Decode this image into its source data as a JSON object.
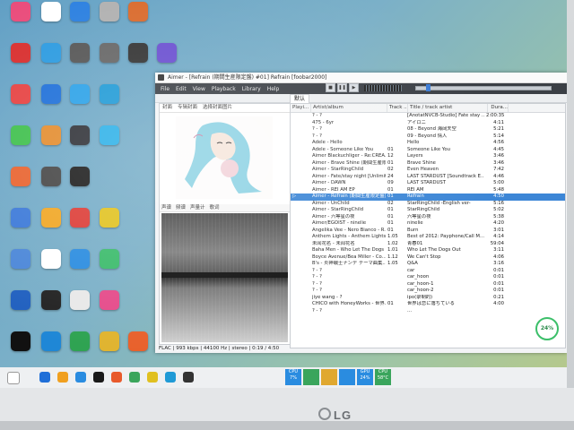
{
  "window": {
    "title": "Aimer - [Refrain (期間生産限定盤) #01] Refrain  [foobar2000]",
    "menu": [
      "File",
      "Edit",
      "View",
      "Playback",
      "Library",
      "Help"
    ],
    "tab": "默认",
    "left_tabs": [
      "封面",
      "专辑封面",
      "选择封面图片"
    ],
    "left_tabs2": [
      "声谱",
      "频谱",
      "声量计",
      "歌词"
    ],
    "status": "FLAC | 993 kbps | 44100 Hz | stereo | 0:19 / 4:50",
    "seek_progress": 0.07
  },
  "playlist": {
    "headers": [
      "Playi...",
      "Artist/album",
      "Track ...",
      "Title / track artist",
      "Dura..."
    ],
    "rows": [
      {
        "artist": "? - ?",
        "track": "",
        "title": "[AnotatNVCB-Studio] Fate stay ...",
        "dur": "2:00:35"
      },
      {
        "artist": "475 - 6yr",
        "track": "",
        "title": "アイロニ",
        "dur": "4:11"
      },
      {
        "artist": "? - ?",
        "track": "",
        "title": "08 - Beyond 海阔天空",
        "dur": "5:21"
      },
      {
        "artist": "? - ?",
        "track": "",
        "title": "09 - Beyond 情人",
        "dur": "5:14"
      },
      {
        "artist": "Adele - Hello",
        "track": "",
        "title": "Hello",
        "dur": "4:56"
      },
      {
        "artist": "Adele - Someone Like You",
        "track": "01",
        "title": "Someone Like You",
        "dur": "4:45"
      },
      {
        "artist": "Aimer Blackuchliger - Re:CREA...",
        "track": "12",
        "title": "Layers",
        "dur": "3:46"
      },
      {
        "artist": "Aimer - Brave Shine (期間生産限定盤)",
        "track": "01",
        "title": "Brave Shine",
        "dur": "3:46"
      },
      {
        "artist": "Aimer - StarRingChild",
        "track": "02",
        "title": "Even Heaven",
        "dur": "7:42"
      },
      {
        "artist": "Aimer - Fate/stay night [Unlimit...",
        "track": "24",
        "title": "LAST STARDUST [Soundtrack E...",
        "dur": "4:46"
      },
      {
        "artist": "Aimer - DAWN",
        "track": "09",
        "title": "LAST STARDUST",
        "dur": "5:00"
      },
      {
        "artist": "Aimer - REI AM EP",
        "track": "01",
        "title": "REI AM",
        "dur": "5:48"
      },
      {
        "artist": "Aimer - Refrain (期間生産限定盤)",
        "track": "01",
        "title": "Refrain",
        "dur": "4:50",
        "playing": true
      },
      {
        "artist": "Aimer - UnChild",
        "track": "02",
        "title": "StarRingChild -English ver-",
        "dur": "5:16"
      },
      {
        "artist": "Aimer - StarRingChild",
        "track": "01",
        "title": "StarRingChild",
        "dur": "5:02"
      },
      {
        "artist": "Aimer - 六等星の夜",
        "track": "01",
        "title": "六等星の夜",
        "dur": "5:38"
      },
      {
        "artist": "Aimer/EGOIST - ninelie",
        "track": "01",
        "title": "ninelie",
        "dur": "4:20"
      },
      {
        "artist": "Angelika Vee - Nero Bianco - R...",
        "track": "01",
        "title": "Burn",
        "dur": "3:01"
      },
      {
        "artist": "Anthem Lights - Anthem Lights ...",
        "track": "1.05",
        "title": "Best of 2012: Payphone/Call M...",
        "dur": "4:14"
      },
      {
        "artist": "未闻花名 - 未闻花名",
        "track": "1.02",
        "title": "青春01",
        "dur": "59:04"
      },
      {
        "artist": "Baha Men - Who Let The Dogs ...",
        "track": "1.01",
        "title": "Who Let The Dogs Out",
        "dur": "3:11"
      },
      {
        "artist": "Boyce Avenue/Bea Miller - Co...",
        "track": "1.12",
        "title": "We Can't Stop",
        "dur": "4:06"
      },
      {
        "artist": "B's - 炎神戦士ナンデ テーマ曲集...",
        "track": "1.05",
        "title": "Q&A",
        "dur": "3:16"
      },
      {
        "artist": "? - ?",
        "track": "",
        "title": "car",
        "dur": "0:01"
      },
      {
        "artist": "? - ?",
        "track": "",
        "title": "car_hoon",
        "dur": "0:01"
      },
      {
        "artist": "? - ?",
        "track": "",
        "title": "car_hoon-1",
        "dur": "0:01"
      },
      {
        "artist": "? - ?",
        "track": "",
        "title": "car_hoon-2",
        "dur": "0:01"
      },
      {
        "artist": "jiye wang - ?",
        "track": "",
        "title": "ipo(录制的)",
        "dur": "0:21"
      },
      {
        "artist": "CHICO with HoneyWorks - 世界...",
        "track": "01",
        "title": "世界は恋に落ちている",
        "dur": "4:00"
      },
      {
        "artist": "? - ?",
        "track": "",
        "title": "...",
        "dur": ""
      }
    ]
  },
  "desktop_icons": [
    {
      "label": "",
      "color": "#e94a7a"
    },
    {
      "label": "",
      "color": "#ffffff"
    },
    {
      "label": "",
      "color": "#2a7fe0"
    },
    {
      "label": "",
      "color": "#b0b0b0"
    },
    {
      "label": "",
      "color": "#d96a2c"
    },
    {
      "label": "",
      "color": "#d82c2c"
    },
    {
      "label": "",
      "color": "#2a9ae0"
    },
    {
      "label": "",
      "color": "#555"
    },
    {
      "label": "",
      "color": "#666"
    },
    {
      "label": "",
      "color": "#333"
    },
    {
      "label": "",
      "color": "#6a4fd0"
    },
    {
      "label": "",
      "color": "#e64040"
    },
    {
      "label": "",
      "color": "#1c6ed8"
    },
    {
      "label": "",
      "color": "#2aa1e8"
    },
    {
      "label": "",
      "color": "#1f9ad6"
    },
    {
      "label": "",
      "color": "#3cbf4a"
    },
    {
      "label": "",
      "color": "#e38b2c"
    },
    {
      "label": "",
      "color": "#2d2f35"
    },
    {
      "label": "",
      "color": "#2bb0e8"
    },
    {
      "label": "",
      "color": "#e8612c"
    },
    {
      "label": "",
      "color": "#444"
    },
    {
      "label": "",
      "color": "#1a1a1a"
    },
    {
      "label": "",
      "color": "#3a78d8"
    },
    {
      "label": "",
      "color": "#f1a623"
    },
    {
      "label": "",
      "color": "#dc3b35"
    },
    {
      "label": "",
      "color": "#e1c21f"
    },
    {
      "label": "",
      "color": "#4a86d8"
    },
    {
      "label": "",
      "color": "#ffffff"
    },
    {
      "label": "",
      "color": "#2a8ce0"
    },
    {
      "label": "",
      "color": "#3bbb6b"
    },
    {
      "label": "",
      "color": "#1f5fbf"
    },
    {
      "label": "",
      "color": "#222"
    },
    {
      "label": "",
      "color": "#e8e8e8"
    },
    {
      "label": "",
      "color": "#e54b8a"
    },
    {
      "label": "",
      "color": "#111"
    },
    {
      "label": "",
      "color": "#1f87d6"
    },
    {
      "label": "",
      "color": "#2fa352"
    },
    {
      "label": "",
      "color": "#e0b430"
    },
    {
      "label": "",
      "color": "#e8612c"
    },
    {
      "label": "",
      "color": "#2a8ce0"
    },
    {
      "label": "",
      "color": "#3a6ac8"
    },
    {
      "label": "",
      "color": "#b84a2c"
    },
    {
      "label": "",
      "color": "#ffffff"
    }
  ],
  "taskbar": {
    "time": "",
    "tray": [
      {
        "label": "CPU 7%",
        "color": "#2a8ce0"
      },
      {
        "label": "",
        "color": "#3aa55c"
      },
      {
        "label": "",
        "color": "#e0a830"
      },
      {
        "label": "",
        "color": "#2a8ce0"
      },
      {
        "label": "GPU 24%",
        "color": "#2a8ce0"
      },
      {
        "label": "CPU 58°C",
        "color": "#3aa55c"
      }
    ]
  },
  "badge": "24%",
  "brand": "LG"
}
